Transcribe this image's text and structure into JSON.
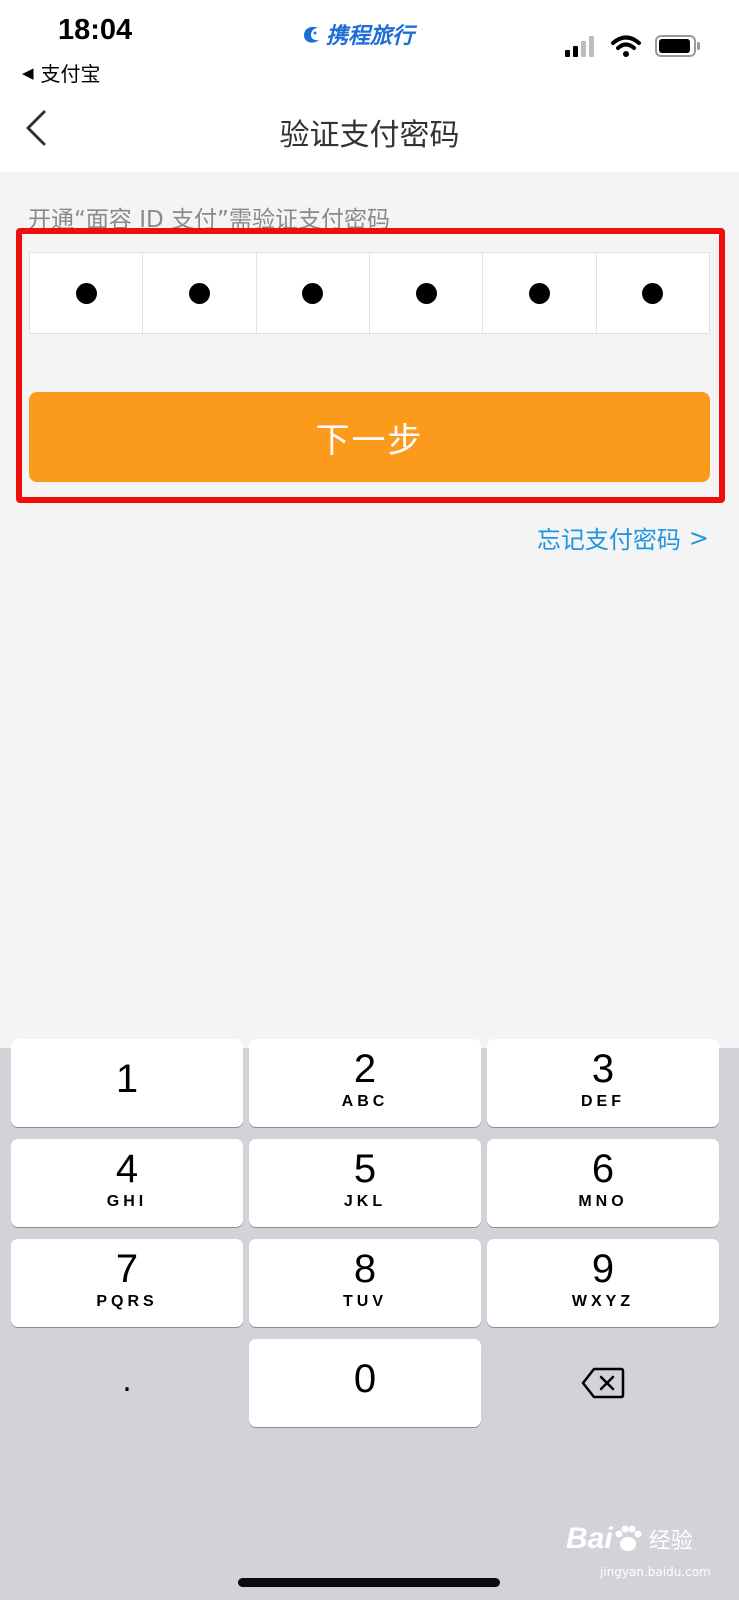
{
  "status_bar": {
    "time": "18:04",
    "back_app_label": "支付宝",
    "brand_name": "携程旅行",
    "brand_color": "#1d6fd8",
    "signal_icon": "cellular-signal-icon",
    "wifi_icon": "wifi-icon",
    "battery_icon": "battery-icon"
  },
  "nav": {
    "title": "验证支付密码",
    "back_icon": "chevron-left-icon"
  },
  "main": {
    "hint": "开通“面容 ID 支付”需验证支付密码",
    "pin_length": 6,
    "pin_filled": 6,
    "next_button_label": "下一步",
    "next_button_color": "#fb9a1b",
    "forgot_label": "忘记支付密码",
    "forgot_chevron": ">",
    "link_color": "#2196e0",
    "highlight_color": "#f20d0d"
  },
  "keyboard": {
    "keys": [
      {
        "digit": "1",
        "letters": ""
      },
      {
        "digit": "2",
        "letters": "ABC"
      },
      {
        "digit": "3",
        "letters": "DEF"
      },
      {
        "digit": "4",
        "letters": "GHI"
      },
      {
        "digit": "5",
        "letters": "JKL"
      },
      {
        "digit": "6",
        "letters": "MNO"
      },
      {
        "digit": "7",
        "letters": "PQRS"
      },
      {
        "digit": "8",
        "letters": "TUV"
      },
      {
        "digit": "9",
        "letters": "WXYZ"
      },
      {
        "digit": "0",
        "letters": ""
      }
    ],
    "dot_key": ".",
    "delete_icon": "backspace-icon"
  },
  "watermark": {
    "logo_text": "Bai",
    "logo_suffix": "经验",
    "url": "jingyan.baidu.com"
  }
}
